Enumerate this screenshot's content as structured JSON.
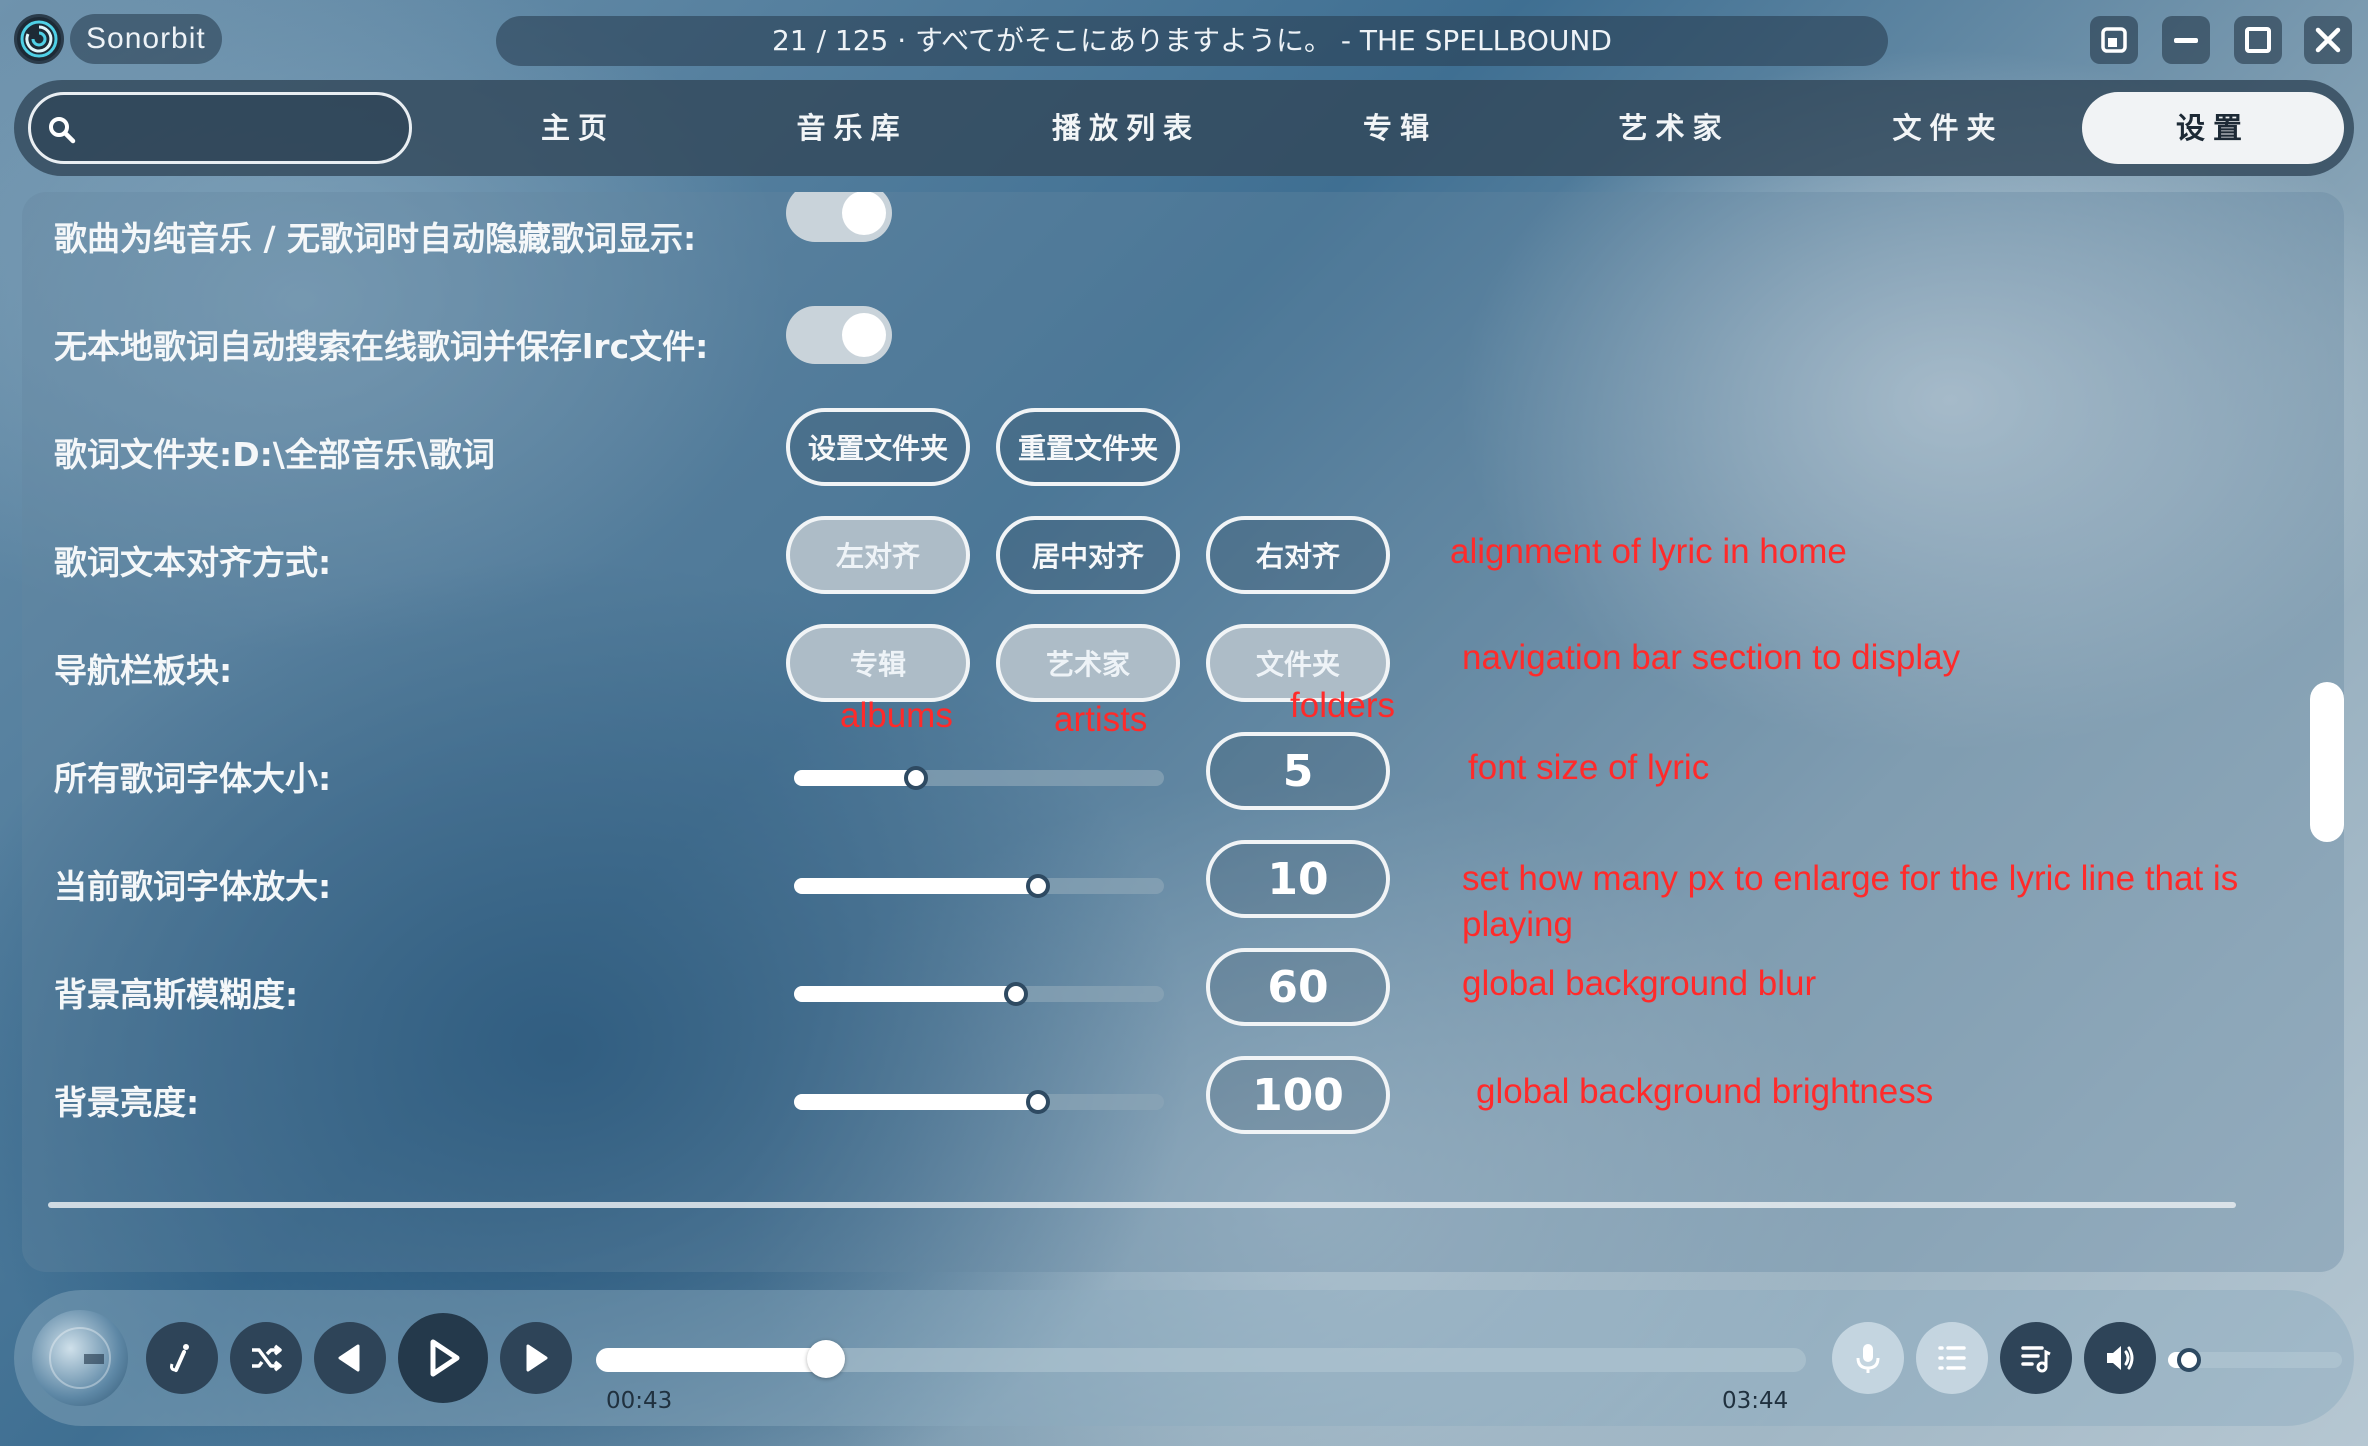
{
  "app": {
    "name": "Sonorbit",
    "now_playing": "21 / 125 · すべてがそこにありますように。 - THE SPELLBOUND"
  },
  "window_controls": [
    "restore-icon",
    "minimize-icon",
    "maximize-icon",
    "close-icon"
  ],
  "search": {
    "value": "",
    "placeholder": ""
  },
  "nav": {
    "tabs": [
      {
        "label": "主页",
        "active": false
      },
      {
        "label": "音乐库",
        "active": false
      },
      {
        "label": "播放列表",
        "active": false
      },
      {
        "label": "专辑",
        "active": false
      },
      {
        "label": "艺术家",
        "active": false
      },
      {
        "label": "文件夹",
        "active": false
      },
      {
        "label": "设置",
        "active": true
      }
    ]
  },
  "settings": {
    "auto_hide_lyrics": {
      "label": "歌曲为纯音乐 / 无歌词时自动隐藏歌词显示:",
      "enabled": true
    },
    "auto_search_lyrics": {
      "label": "无本地歌词自动搜索在线歌词并保存lrc文件:",
      "enabled": true
    },
    "lyrics_folder": {
      "label": "歌词文件夹:D:\\全部音乐\\歌词",
      "set_button": "设置文件夹",
      "reset_button": "重置文件夹"
    },
    "lyric_alignment": {
      "label": "歌词文本对齐方式:",
      "options": [
        "左对齐",
        "居中对齐",
        "右对齐"
      ],
      "selected": "左对齐"
    },
    "nav_sections": {
      "label": "导航栏板块:",
      "options": [
        "专辑",
        "艺术家",
        "文件夹"
      ],
      "enabled": [
        "专辑",
        "艺术家",
        "文件夹"
      ]
    },
    "lyric_font_size": {
      "label": "所有歌词字体大小:",
      "value": "5",
      "fraction": 0.33
    },
    "current_lyric_enlarge": {
      "label": "当前歌词字体放大:",
      "value": "10",
      "fraction": 0.66
    },
    "bg_blur": {
      "label": "背景高斯模糊度:",
      "value": "60",
      "fraction": 0.6
    },
    "bg_brightness": {
      "label": "背景亮度:",
      "value": "100",
      "fraction": 0.66
    }
  },
  "annotations": {
    "alignment": "alignment of lyric in home",
    "nav_sections": "navigation bar section to display",
    "albums": "albums",
    "artists": "artists",
    "folders": "folders",
    "font_size": "font size of lyric",
    "enlarge": "set how many px to enlarge for the lyric line that is playing",
    "blur": "global background blur",
    "brightness": "global background brightness"
  },
  "player": {
    "current_time": "00:43",
    "total_time": "03:44",
    "progress": 0.19,
    "volume": 0.12
  },
  "colors": {
    "annotation": "#ff2a2a",
    "active_tab_bg": "#f1f3f5",
    "dark_button": "#2e4458"
  }
}
